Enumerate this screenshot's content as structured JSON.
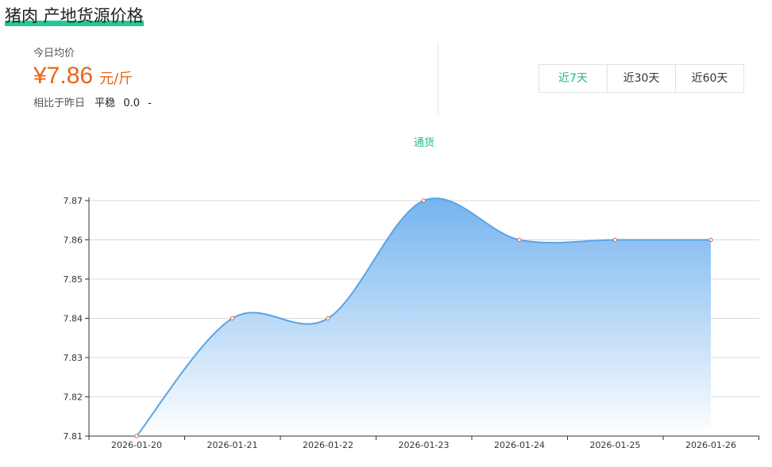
{
  "header": {
    "title": "猪肉 产地货源价格"
  },
  "summary": {
    "label": "今日均价",
    "price": "¥7.86",
    "unit": "元/斤",
    "compare_label": "相比于昨日",
    "compare_status": "平稳",
    "compare_value": "0.0",
    "compare_arrow": "-"
  },
  "tabs": [
    {
      "label": "近7天",
      "active": true
    },
    {
      "label": "近30天",
      "active": false
    },
    {
      "label": "近60天",
      "active": false
    }
  ],
  "colors": {
    "accent": "#20c997",
    "price": "#e8651a",
    "line": "#5aa5e6",
    "fill_top": "#7db8f0",
    "point": "#e05a5a"
  },
  "chart_data": {
    "type": "area",
    "title": "通货",
    "x": [
      "2026-01-20",
      "2026-01-21",
      "2026-01-22",
      "2026-01-23",
      "2026-01-24",
      "2026-01-25",
      "2026-01-26"
    ],
    "series": [
      {
        "values": [
          7.81,
          7.84,
          7.84,
          7.87,
          7.86,
          7.86,
          7.86
        ]
      }
    ],
    "ylim": [
      7.81,
      7.87
    ],
    "yticks": [
      "7.81",
      "7.82",
      "7.83",
      "7.84",
      "7.85",
      "7.86",
      "7.87"
    ],
    "grid": true,
    "smooth": true
  }
}
